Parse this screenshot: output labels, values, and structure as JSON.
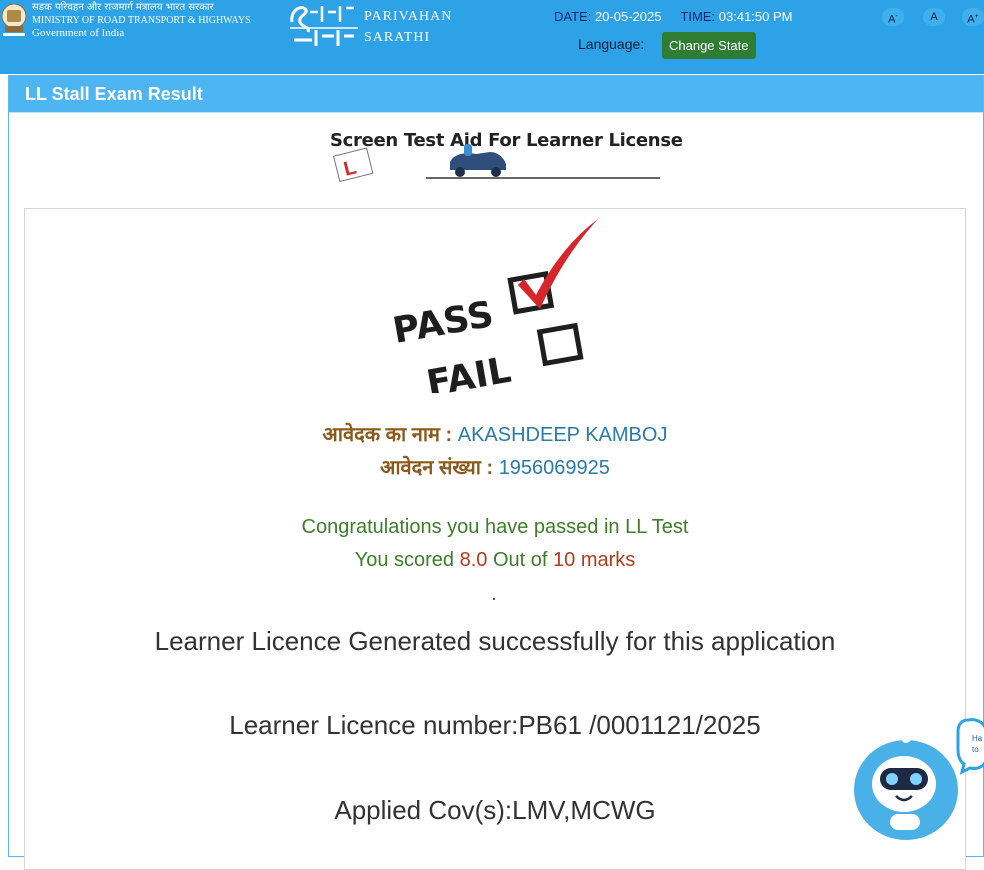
{
  "header": {
    "gov_line1": "सड़क परिवहन और राजमार्ग मंत्रालय भारत सरकार",
    "gov_line2": "MINISTRY OF ROAD TRANSPORT & HIGHWAYS",
    "gov_line3": "Government of India",
    "parivahan": "PARIVAHAN",
    "sarathi": "SARATHI",
    "date_label": "DATE:",
    "date_value": "20-05-2025",
    "time_label": "TIME:",
    "time_value": "03:41:50 PM",
    "language_label": "Language:",
    "change_state_label": "Change State",
    "font_decrease": "A",
    "font_decrease_sup": "-",
    "font_normal": "A",
    "font_increase": "A",
    "font_increase_sup": "+"
  },
  "panel": {
    "title": "LL Stall Exam Result",
    "screen_test_title": "Screen Test Aid For Learner License"
  },
  "graphic": {
    "pass_text": "PASS",
    "fail_text": "FAIL",
    "ll_badge": "L"
  },
  "result": {
    "applicant_label": "आवेदक का नाम :",
    "applicant_name": "AKASHDEEP KAMBOJ",
    "appno_label": "आवेदन संख्या :",
    "appno_value": "1956069925",
    "congrats": "Congratulations you have passed in LL Test",
    "scored_prefix": "You scored",
    "score": "8.0",
    "scored_mid": "Out of",
    "total": "10 marks",
    "generated": "Learner Licence Generated successfully for this application",
    "licence_number": "Learner Licence number:PB61 /0001121/2025",
    "cov": "Applied Cov(s):LMV,MCWG"
  },
  "chatbot": {
    "bubble_line1": "Ha",
    "bubble_line2": "to"
  },
  "colors": {
    "header_bg": "#2da2e6",
    "panel_head": "#4db6f2",
    "success_green": "#3e7d2a",
    "score_red": "#b33b1d",
    "label_orange": "#8b5a1a",
    "value_teal": "#2a7ba8"
  }
}
